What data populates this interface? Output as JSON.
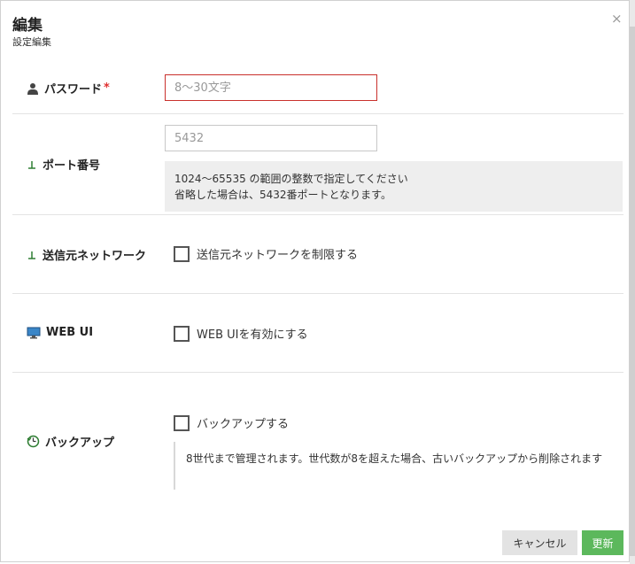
{
  "header": {
    "title": "編集",
    "subtitle": "設定編集",
    "close": "×"
  },
  "fields": {
    "password": {
      "label": "パスワード",
      "required": "*",
      "placeholder": "8〜30文字",
      "value": ""
    },
    "port": {
      "label": "ポート番号",
      "placeholder": "5432",
      "value": "",
      "hint_line1": "1024〜65535 の範囲の整数で指定してください",
      "hint_line2": "省略した場合は、5432番ポートとなります。"
    },
    "network": {
      "label": "送信元ネットワーク",
      "checkbox_label": "送信元ネットワークを制限する",
      "checked": false
    },
    "webui": {
      "label": "WEB UI",
      "checkbox_label": "WEB UIを有効にする",
      "checked": false
    },
    "backup": {
      "label": "バックアップ",
      "checkbox_label": "バックアップする",
      "checked": false,
      "hint": "8世代まで管理されます。世代数が8を超えた場合、古いバックアップから削除されます"
    }
  },
  "footer": {
    "cancel_label": "キャンセル",
    "save_label": "更新"
  },
  "colors": {
    "save": "#5cb85c",
    "cancel": "#e3e3e3",
    "error_border": "#c9302c",
    "required": "#e03030"
  },
  "icons": [
    "user-icon",
    "pin-icon",
    "monitor-icon",
    "backup-clock-icon",
    "close-icon"
  ]
}
